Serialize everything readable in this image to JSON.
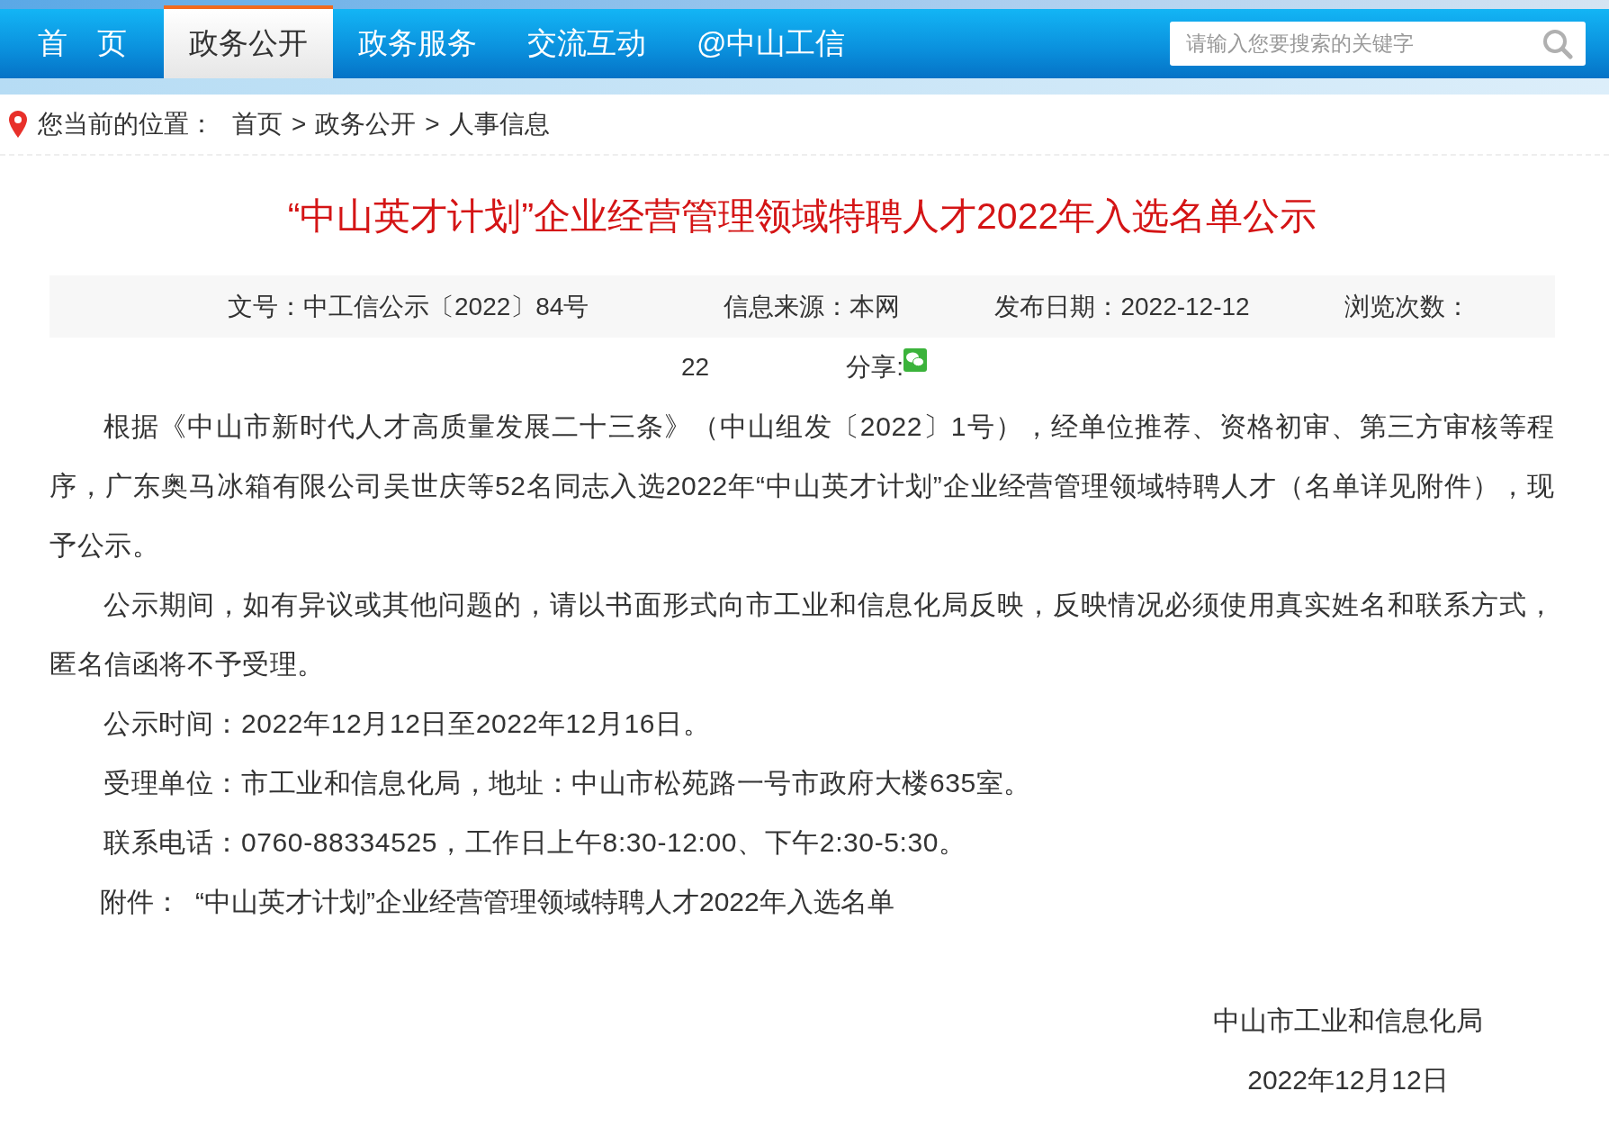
{
  "nav": {
    "tabs": [
      {
        "label": "首　页",
        "selected": false
      },
      {
        "label": "政务公开",
        "selected": true
      },
      {
        "label": "政务服务",
        "selected": false
      },
      {
        "label": "交流互动",
        "selected": false
      },
      {
        "label": "@中山工信",
        "selected": false
      }
    ],
    "search": {
      "placeholder": "请输入您要搜索的关键字"
    }
  },
  "breadcrumb": {
    "label": "您当前的位置：",
    "items": [
      "首页",
      "政务公开",
      "人事信息"
    ],
    "separator": ">"
  },
  "article": {
    "title": "“中山英才计划”企业经营管理领域特聘人才2022年入选名单公示",
    "meta": {
      "doc_no": "文号：中工信公示〔2022〕84号",
      "source": "信息来源：本网",
      "date": "发布日期：2022-12-12",
      "views_label": "浏览次数：",
      "views": "22",
      "share_label": "分享:"
    },
    "paragraphs": [
      "根据《中山市新时代人才高质量发展二十三条》（中山组发〔2022〕1号），经单位推荐、资格初审、第三方审核等程序，广东奥马冰箱有限公司吴世庆等52名同志入选2022年“中山英才计划”企业经营管理领域特聘人才（名单详见附件），现予公示。",
      "公示期间，如有异议或其他问题的，请以书面形式向市工业和信息化局反映，反映情况必须使用真实姓名和联系方式，匿名信函将不予受理。",
      "公示时间：2022年12月12日至2022年12月16日。",
      "受理单位：市工业和信息化局，地址：中山市松苑路一号市政府大楼635室。",
      "联系电话：0760-88334525，工作日上午8:30-12:00、下午2:30-5:30。"
    ],
    "attachment": {
      "label": "附件：",
      "link": "“中山英才计划”企业经营管理领域特聘人才2022年入选名单"
    },
    "signature": {
      "org": "中山市工业和信息化局",
      "date": "2022年12月12日"
    }
  }
}
